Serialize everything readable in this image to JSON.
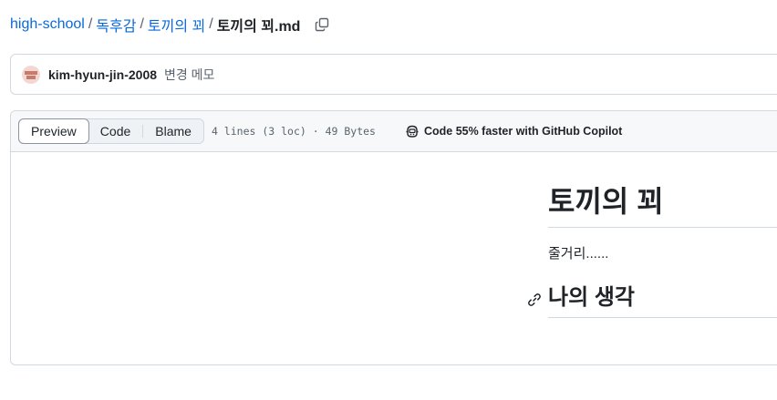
{
  "breadcrumb": {
    "repo": "high-school",
    "folder1": "독후감",
    "folder2": "토끼의 꾀",
    "file": "토끼의 꾀.md",
    "separator": "/"
  },
  "commit": {
    "user": "kim-hyun-jin-2008",
    "message": "변경 메모"
  },
  "file_header": {
    "tabs": [
      "Preview",
      "Code",
      "Blame"
    ],
    "active_tab": "Preview",
    "meta": "4 lines (3 loc) · 49 Bytes",
    "copilot_text": "Code 55% faster with GitHub Copilot"
  },
  "markdown": {
    "h1": "토끼의 꾀",
    "paragraph": "줄거리......",
    "h2": "나의 생각"
  },
  "colors": {
    "link": "#0969da",
    "border": "#d1d9e0",
    "header_bg": "#f6f8fa"
  },
  "icons": [
    "copy-icon",
    "avatar",
    "copilot-icon",
    "link-icon"
  ]
}
